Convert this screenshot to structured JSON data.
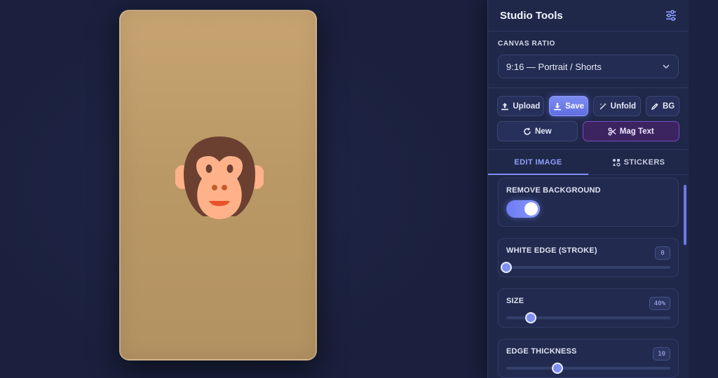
{
  "panel": {
    "title": "Studio Tools",
    "settings_icon": "sliders-icon"
  },
  "canvas_ratio": {
    "label": "CANVAS RATIO",
    "selected": "9:16 — Portrait / Shorts"
  },
  "actions": {
    "upload": "Upload",
    "save": "Save",
    "unfold": "Unfold",
    "bg": "BG",
    "new": "New",
    "mag_text": "Mag Text"
  },
  "tabs": [
    {
      "label": "EDIT IMAGE",
      "active": true
    },
    {
      "label": "STICKERS",
      "active": false
    }
  ],
  "controls": {
    "remove_background": {
      "label": "REMOVE BACKGROUND",
      "on": true
    },
    "white_edge": {
      "label": "WHITE EDGE (STROKE)",
      "value": "0",
      "fraction": 0.0
    },
    "size": {
      "label": "SIZE",
      "value": "40%",
      "fraction": 0.15
    },
    "edge_thickness": {
      "label": "EDGE THICKNESS",
      "value": "10",
      "fraction": 0.31
    }
  },
  "canvas": {
    "background_color": "#bd9b68",
    "sticker": "monkey-face-emoji"
  },
  "colors": {
    "accent": "#7f8ff5",
    "panel_bg": "#20284a",
    "app_bg": "#1b2140",
    "mag_text_bg": "#3b2460"
  }
}
